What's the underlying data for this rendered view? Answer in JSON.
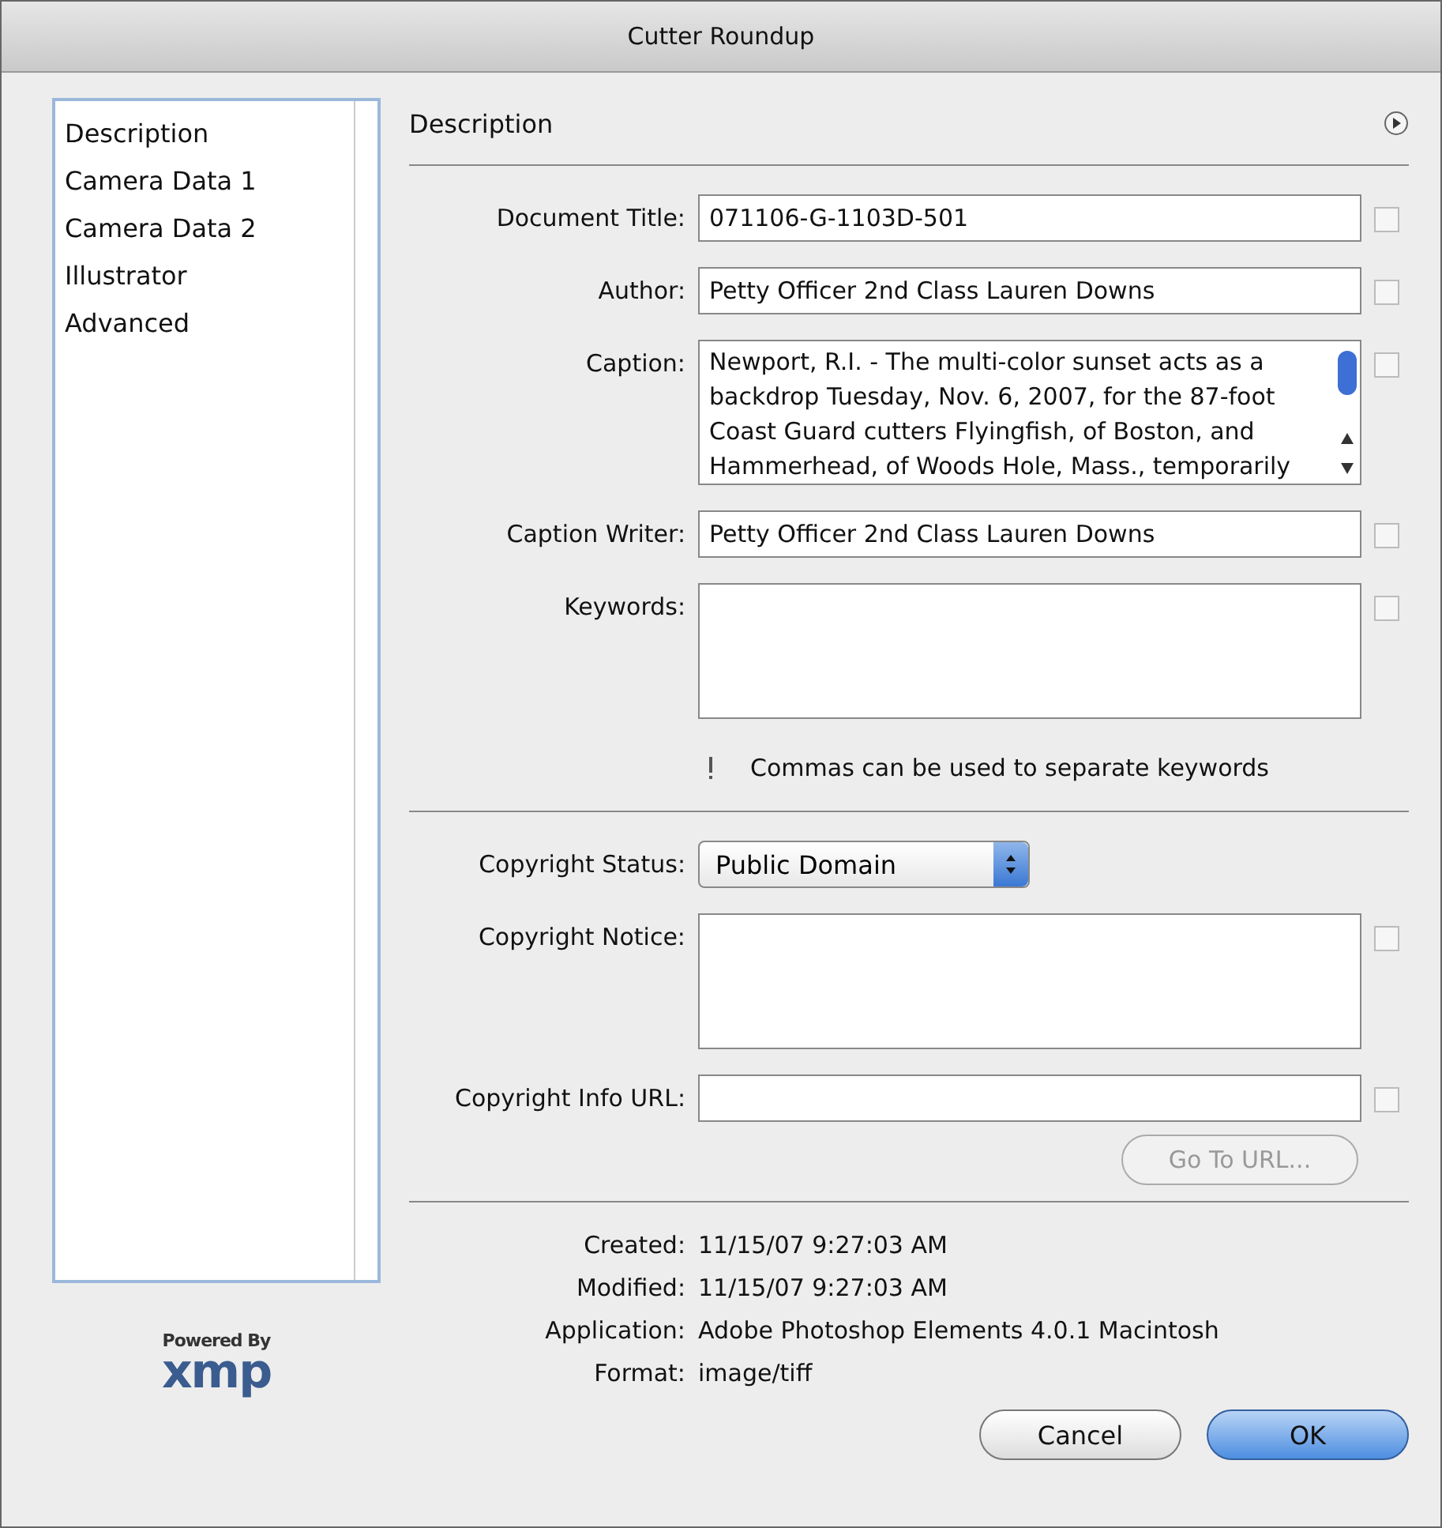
{
  "window": {
    "title": "Cutter Roundup"
  },
  "sidebar": {
    "items": [
      {
        "label": "Description"
      },
      {
        "label": "Camera Data 1"
      },
      {
        "label": "Camera Data 2"
      },
      {
        "label": "Illustrator"
      },
      {
        "label": "Advanced"
      }
    ]
  },
  "logo": {
    "caption": "Powered By",
    "name": "xmp"
  },
  "panel": {
    "title": "Description",
    "fields": [
      {
        "kind": "text",
        "label": "Document Title:",
        "value": "071106-G-1103D-501",
        "menu_button": true
      },
      {
        "kind": "text",
        "label": "Author:",
        "value": "Petty Officer 2nd Class Lauren Downs",
        "menu_button": true
      },
      {
        "kind": "textarea",
        "label": "Caption:",
        "value": "Newport, R.I. - The multi-color sunset acts as a backdrop Tuesday, Nov. 6, 2007, for the 87-foot Coast Guard cutters Flyingfish, of Boston, and Hammerhead, of Woods Hole, Mass., temporarily",
        "scrollbar": true,
        "menu_button": true
      },
      {
        "kind": "text",
        "label": "Caption Writer:",
        "value": "Petty Officer 2nd Class Lauren Downs",
        "menu_button": true
      },
      {
        "kind": "textarea",
        "label": "Keywords:",
        "menu_button": true
      },
      {
        "kind": "hint",
        "text": "Commas can be used to separate keywords"
      },
      {
        "kind": "rule"
      },
      {
        "kind": "popup",
        "label": "Copyright Status:",
        "value": "Public Domain",
        "menu_button": false
      },
      {
        "kind": "textarea",
        "label": "Copyright Notice:",
        "menu_button": true
      },
      {
        "kind": "text",
        "label": "Copyright Info URL:",
        "menu_button": true
      },
      {
        "kind": "button",
        "label": "Go To URL...",
        "disabled": true
      }
    ],
    "info": [
      {
        "label": "Created:",
        "value": "11/15/07 9:27:03 AM"
      },
      {
        "label": "Modified:",
        "value": "11/15/07 9:27:03 AM"
      },
      {
        "label": "Application:",
        "value": "Adobe Photoshop Elements 4.0.1 Macintosh"
      },
      {
        "label": "Format:",
        "value": "image/tiff"
      }
    ]
  },
  "buttons": [
    {
      "label": "Cancel",
      "default": false
    },
    {
      "label": "OK",
      "default": true
    }
  ]
}
